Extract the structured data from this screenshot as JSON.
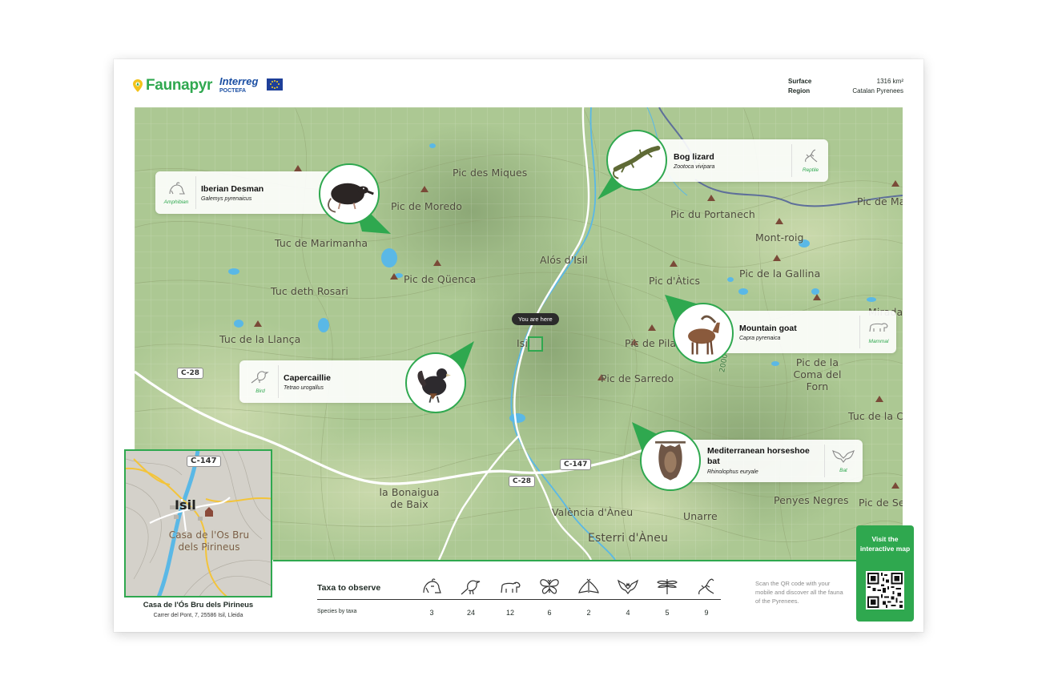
{
  "header": {
    "brand": "Faunapyr",
    "partner_line1": "Interreg",
    "partner_line2": "POCTEFA",
    "meta": [
      {
        "label": "Surface",
        "value": "1316 km²"
      },
      {
        "label": "Region",
        "value": "Catalan Pyrenees"
      }
    ]
  },
  "map": {
    "places": [
      {
        "id": "miques",
        "label": "Pic des Miques"
      },
      {
        "id": "moredo",
        "label": "Pic de Moredo"
      },
      {
        "id": "marimanha",
        "label": "Tuc de Marimanha"
      },
      {
        "id": "quenca",
        "label": "Pic de Qüenca"
      },
      {
        "id": "rosari",
        "label": "Tuc deth Rosari"
      },
      {
        "id": "llanca",
        "label": "Tuc de la Llança"
      },
      {
        "id": "alos",
        "label": "Alós d'Isil"
      },
      {
        "id": "isil",
        "label": "Isil"
      },
      {
        "id": "portanech",
        "label": "Pic du Portanech"
      },
      {
        "id": "montroig",
        "label": "Mont-roig"
      },
      {
        "id": "atics",
        "label": "Pic d'Àtics"
      },
      {
        "id": "gallina",
        "label": "Pic de la Gallina"
      },
      {
        "id": "pila",
        "label": "Pic de Pila"
      },
      {
        "id": "sarredo",
        "label": "Pic de Sarredo"
      },
      {
        "id": "coma",
        "label": "Pic de la Coma del Forn"
      },
      {
        "id": "tuccia",
        "label": "Tuc de la Ci"
      },
      {
        "id": "picma",
        "label": "Pic de Ma"
      },
      {
        "id": "mirada",
        "label": "Mirada"
      },
      {
        "id": "bonaigua",
        "label": "la Bonaigua de Baix"
      },
      {
        "id": "valencia",
        "label": "València d'Àneu"
      },
      {
        "id": "esterri",
        "label": "Esterri d'Àneu"
      },
      {
        "id": "unarre",
        "label": "Unarre"
      },
      {
        "id": "penyes",
        "label": "Penyes Negres"
      },
      {
        "id": "picse",
        "label": "Pic de Se"
      }
    ],
    "roads": [
      "C-28",
      "C-147",
      "C-28"
    ],
    "contour_label": "2000",
    "you_are_here": "You are here"
  },
  "species": [
    {
      "name": "Iberian Desman",
      "latin": "Galemys pyrenaicus",
      "taxon": "Amphibian",
      "icon": "frog-icon"
    },
    {
      "name": "Bog lizard",
      "latin": "Zootoca vivipara",
      "taxon": "Reptile",
      "icon": "lizard-icon"
    },
    {
      "name": "Mountain goat",
      "latin": "Capra pyrenaica",
      "taxon": "Mammal",
      "icon": "bear-icon"
    },
    {
      "name": "Capercaillie",
      "latin": "Tetrao urogallus",
      "taxon": "Bird",
      "icon": "bird-icon"
    },
    {
      "name": "Mediterranean horseshoe bat",
      "latin": "Rhinolophus euryale",
      "taxon": "Bat",
      "icon": "bat-icon"
    }
  ],
  "inset": {
    "road": "C-147",
    "town": "Isil",
    "poi": "Casa de l'Os Bru dels Pirineus",
    "title": "Casa de l'Ós Bru dels Pirineus",
    "address": "Carrer del Pont, 7, 25586 Isil, Lleida"
  },
  "taxa": {
    "title": "Taxa to observe",
    "subtitle": "Species by taxa",
    "items": [
      {
        "icon": "frog-icon",
        "count": "3"
      },
      {
        "icon": "bird-icon",
        "count": "24"
      },
      {
        "icon": "bear-icon",
        "count": "12"
      },
      {
        "icon": "butterfly-icon",
        "count": "6"
      },
      {
        "icon": "moth-icon",
        "count": "2"
      },
      {
        "icon": "bat-icon",
        "count": "4"
      },
      {
        "icon": "dragonfly-icon",
        "count": "5"
      },
      {
        "icon": "lizard-icon",
        "count": "9"
      }
    ]
  },
  "qr": {
    "text": "Scan the QR code with your mobile and discover all the fauna of the Pyrenees.",
    "button": "Visit the interactive map"
  },
  "colors": {
    "accent": "#2fa84f",
    "map_green": "#a9c590",
    "peak": "#7a4a38",
    "water": "#5ab8e6"
  }
}
